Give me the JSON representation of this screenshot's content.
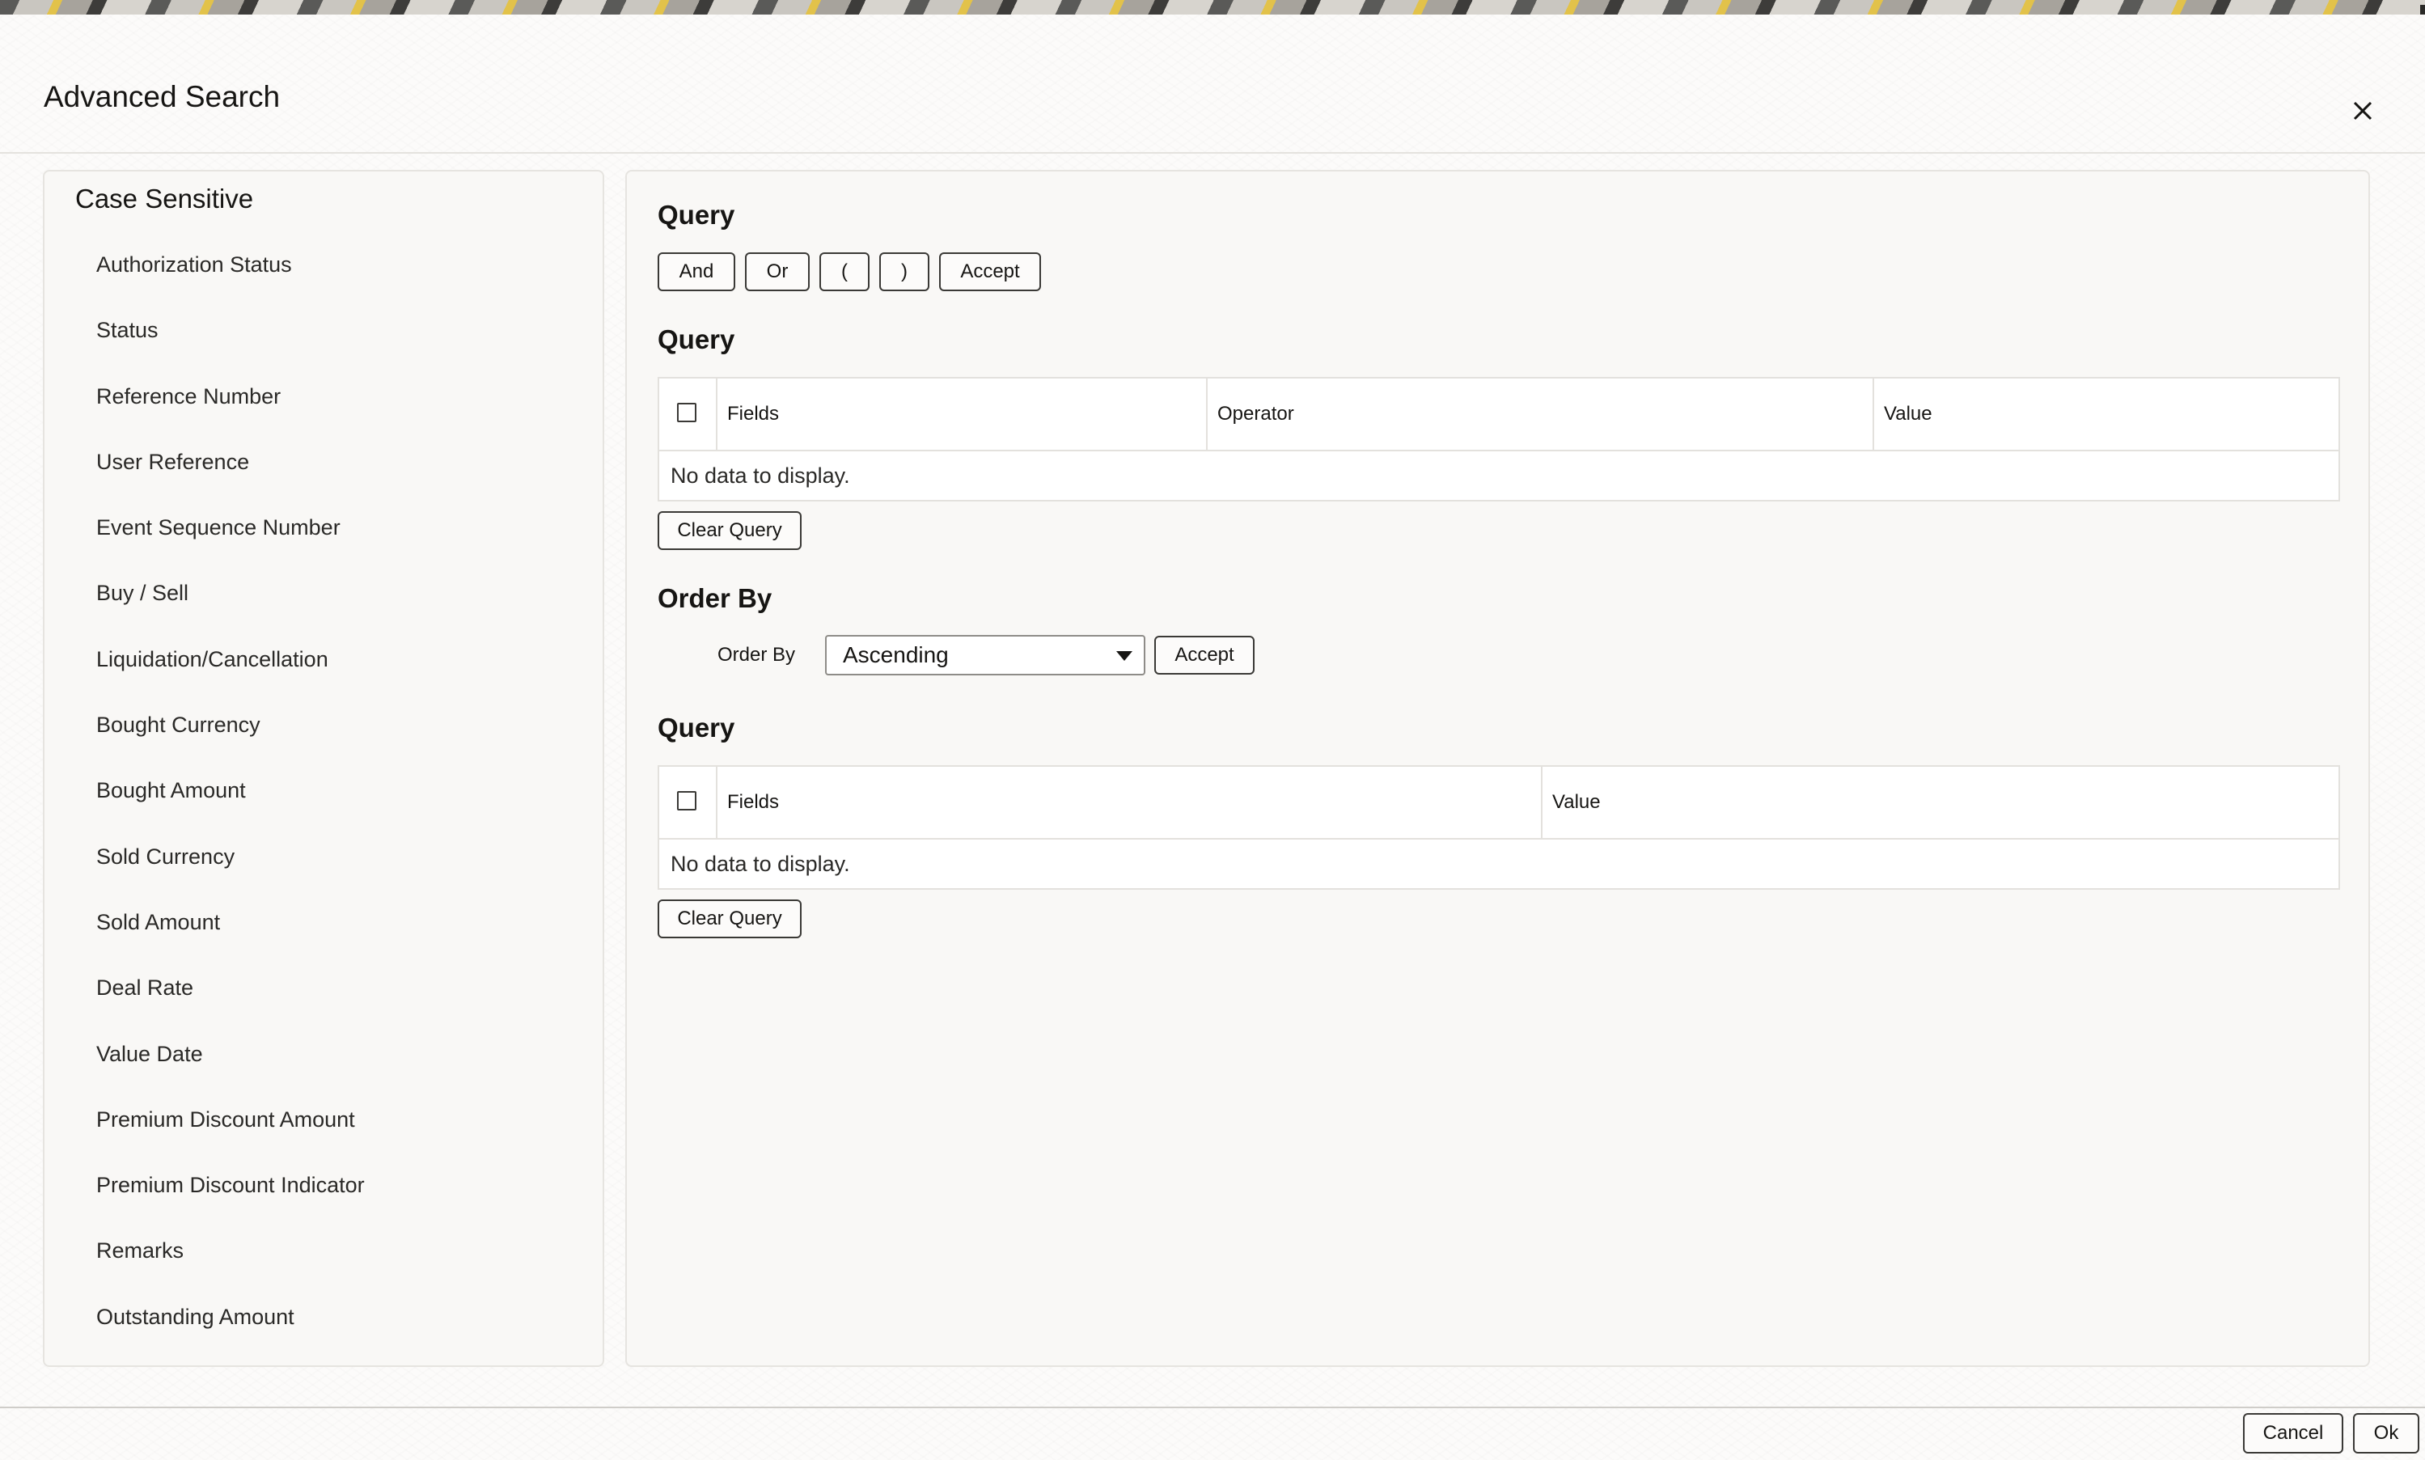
{
  "dialog": {
    "title": "Advanced Search",
    "close_icon": "close-icon"
  },
  "left_panel": {
    "heading": "Case Sensitive",
    "fields": [
      "Authorization Status",
      "Status",
      "Reference Number",
      "User Reference",
      "Event Sequence Number",
      "Buy / Sell",
      "Liquidation/Cancellation",
      "Bought Currency",
      "Bought Amount",
      "Sold Currency",
      "Sold Amount",
      "Deal Rate",
      "Value Date",
      "Premium Discount Amount",
      "Premium Discount Indicator",
      "Remarks",
      "Outstanding Amount"
    ]
  },
  "query_builder": {
    "title": "Query",
    "buttons": {
      "and": "And",
      "or": "Or",
      "open_paren": "(",
      "close_paren": ")",
      "accept": "Accept"
    }
  },
  "query_table": {
    "title": "Query",
    "columns": [
      "Fields",
      "Operator",
      "Value"
    ],
    "empty_text": "No data to display.",
    "clear_button": "Clear Query"
  },
  "order_by": {
    "title": "Order By",
    "label": "Order By",
    "selected": "Ascending",
    "accept_button": "Accept"
  },
  "order_table": {
    "title": "Query",
    "columns": [
      "Fields",
      "Value"
    ],
    "empty_text": "No data to display.",
    "clear_button": "Clear Query"
  },
  "footer": {
    "cancel": "Cancel",
    "ok": "Ok"
  }
}
